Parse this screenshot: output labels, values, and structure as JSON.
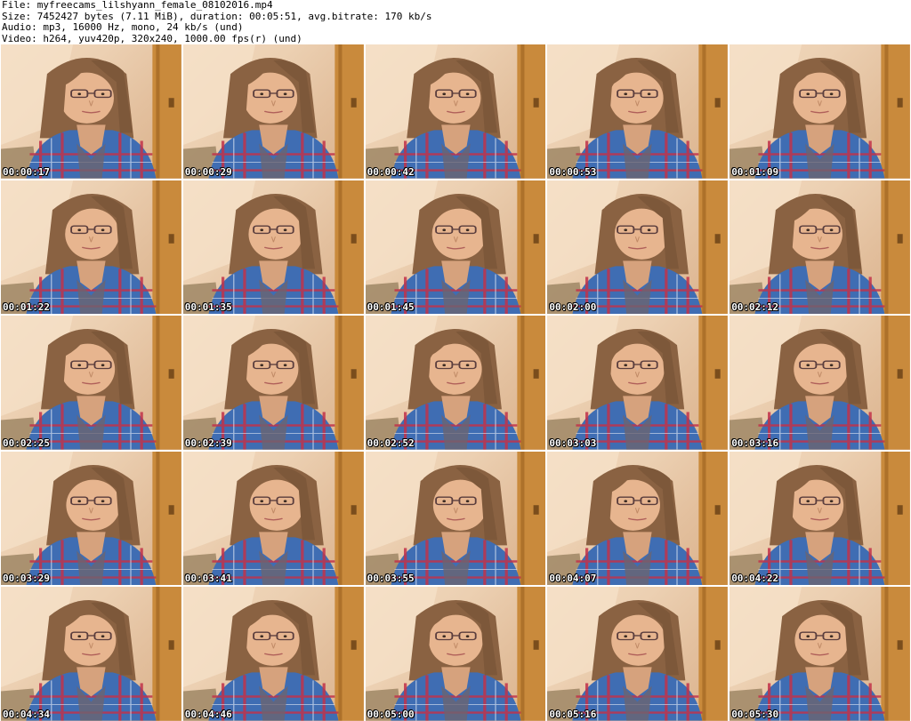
{
  "header": {
    "line1": "File: myfreecams_lilshyann_female_08102016.mp4",
    "line2": "Size: 7452427 bytes (7.11 MiB), duration: 00:05:51, avg.bitrate: 170 kb/s",
    "line3": "Audio: mp3, 16000 Hz, mono, 24 kb/s (und)",
    "line4": "Video: h264, yuv420p, 320x240, 1000.00 fps(r) (und)"
  },
  "thumbnails": [
    {
      "timestamp": "00:00:17"
    },
    {
      "timestamp": "00:00:29"
    },
    {
      "timestamp": "00:00:42"
    },
    {
      "timestamp": "00:00:53"
    },
    {
      "timestamp": "00:01:09"
    },
    {
      "timestamp": "00:01:22"
    },
    {
      "timestamp": "00:01:35"
    },
    {
      "timestamp": "00:01:45"
    },
    {
      "timestamp": "00:02:00"
    },
    {
      "timestamp": "00:02:12"
    },
    {
      "timestamp": "00:02:25"
    },
    {
      "timestamp": "00:02:39"
    },
    {
      "timestamp": "00:02:52"
    },
    {
      "timestamp": "00:03:03"
    },
    {
      "timestamp": "00:03:16"
    },
    {
      "timestamp": "00:03:29"
    },
    {
      "timestamp": "00:03:41"
    },
    {
      "timestamp": "00:03:55"
    },
    {
      "timestamp": "00:04:07"
    },
    {
      "timestamp": "00:04:22"
    },
    {
      "timestamp": "00:04:34"
    },
    {
      "timestamp": "00:04:46"
    },
    {
      "timestamp": "00:05:00"
    },
    {
      "timestamp": "00:05:16"
    },
    {
      "timestamp": "00:05:30"
    }
  ],
  "colors": {
    "wall": "#efd4b6",
    "door": "#c98a3c",
    "hair": "#8a6242",
    "skin": "#e7b58f",
    "shirt": "#3f6db3",
    "plaid": "#c2334a",
    "timestamp_text": "#ffffff"
  }
}
